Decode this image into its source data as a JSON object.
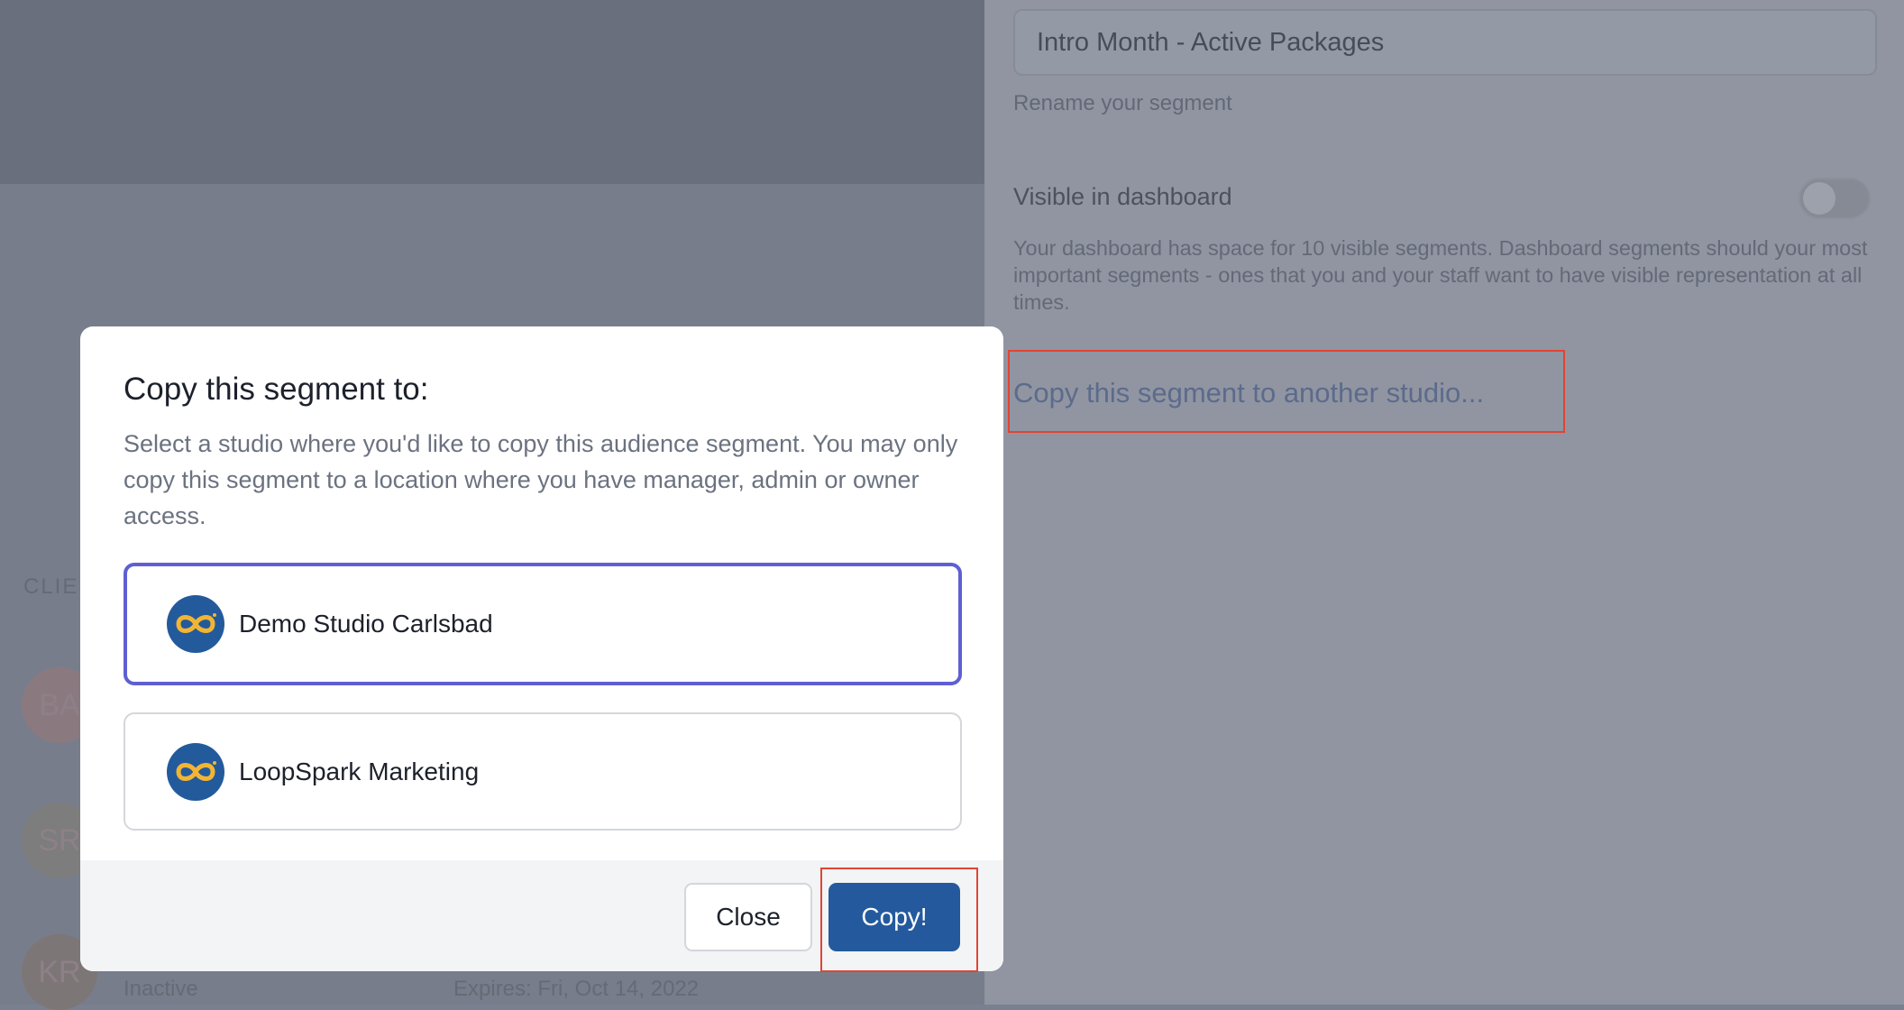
{
  "background": {
    "clients_label": "CLIEN",
    "avatars": [
      "BA",
      "SR",
      "KR"
    ],
    "row_status": "Inactive",
    "row_expires": "Expires: Fri, Oct 14, 2022"
  },
  "segment_panel": {
    "name_value": "Intro Month - Active Packages",
    "name_help": "Rename your segment",
    "visible_label": "Visible in dashboard",
    "visible_toggle_on": false,
    "visible_description": "Your dashboard has space for 10 visible segments. Dashboard segments should your most important segments - ones that you and your staff want to have visible representation at all times.",
    "copy_link": "Copy this segment to another studio..."
  },
  "modal": {
    "title": "Copy this segment to:",
    "description": "Select a studio where you'd like to copy this audience segment. You may only copy this segment to a location where you have manager, admin or owner access.",
    "studios": [
      {
        "name": "Demo Studio Carlsbad",
        "selected": true,
        "logo": "loopspark-logo-icon"
      },
      {
        "name": "LoopSpark Marketing",
        "selected": false,
        "logo": "loopspark-logo-icon"
      }
    ],
    "close_label": "Close",
    "copy_label": "Copy!"
  },
  "colors": {
    "overlay": "#787d8b",
    "selected_border": "#5f5fd3",
    "primary_button": "#245a9d",
    "annotation_highlight": "#e24433",
    "logo_bg": "#235a9c",
    "logo_ring": "#f2b533"
  }
}
